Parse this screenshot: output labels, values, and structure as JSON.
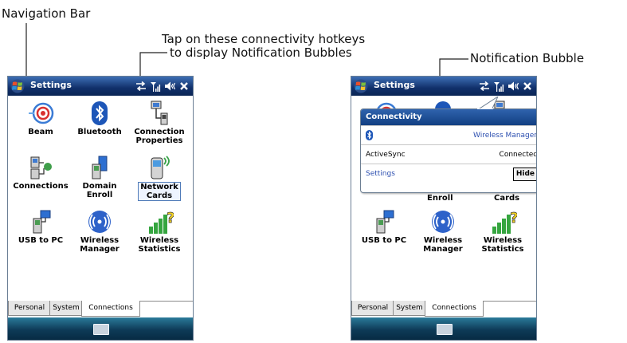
{
  "callouts": {
    "nav_bar": "Navigation Bar",
    "hotkeys_line1": "Tap on these connectivity hotkeys",
    "hotkeys_line2": "to display Notification Bubbles",
    "bubble": "Notification Bubble"
  },
  "device": {
    "title": "Settings",
    "apps": [
      {
        "label": "Beam",
        "icon": "beam-icon"
      },
      {
        "label": "Bluetooth",
        "icon": "bluetooth-icon"
      },
      {
        "label": "Connection\nProperties",
        "icon": "connection-properties-icon"
      },
      {
        "label": "Connections",
        "icon": "connections-icon"
      },
      {
        "label": "Domain\nEnroll",
        "icon": "domain-enroll-icon"
      },
      {
        "label": "Network\nCards",
        "icon": "network-cards-icon"
      },
      {
        "label": "USB to PC",
        "icon": "usb-to-pc-icon"
      },
      {
        "label": "Wireless\nManager",
        "icon": "wireless-manager-icon"
      },
      {
        "label": "Wireless\nStatistics",
        "icon": "wireless-statistics-icon"
      }
    ],
    "right_partial": {
      "enroll": "Enroll",
      "cards": "Cards"
    },
    "tabs": [
      "Personal",
      "System",
      "Connections"
    ],
    "active_tab": "Connections"
  },
  "bubble": {
    "title": "Connectivity",
    "wireless_manager": "Wireless Manager",
    "activesync_label": "ActiveSync",
    "activesync_status": "Connected",
    "settings_link": "Settings",
    "hide_button": "Hide"
  },
  "colors": {
    "title_bar": "#11306a",
    "menu_bar": "#0e3b58",
    "bubble_title": "#1f4e96",
    "link": "#2c4fb0"
  }
}
